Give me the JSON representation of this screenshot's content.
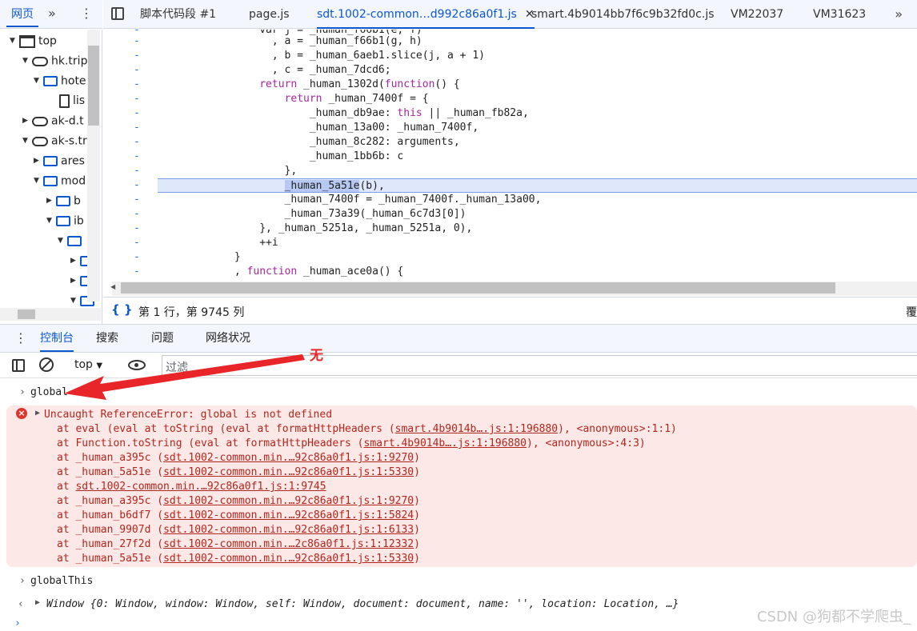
{
  "left_panel": {
    "active_tab": "网页",
    "tree": [
      {
        "label": "top"
      },
      {
        "label": "hk.trip"
      },
      {
        "label": "hote"
      },
      {
        "label": "lis"
      },
      {
        "label": "ak-d.t"
      },
      {
        "label": "ak-s.tr"
      },
      {
        "label": "ares"
      },
      {
        "label": "mod"
      },
      {
        "label": "b"
      },
      {
        "label": "ib"
      },
      {
        "label": ""
      },
      {
        "label": ""
      },
      {
        "label": ""
      },
      {
        "label": ""
      }
    ]
  },
  "file_tabs": [
    {
      "label": "脚本代码段 #1"
    },
    {
      "label": "page.js"
    },
    {
      "label": "sdt.1002-common…d992c86a0f1.js",
      "active": true
    },
    {
      "label": "smart.4b9014bb7f6c9b32fd0c.js"
    },
    {
      "label": "VM22037"
    },
    {
      "label": "VM31623"
    }
  ],
  "code": {
    "gutter_marker": "-",
    "lines": [
      "                var j = _human_f66b1(e, f)",
      "                  , a = _human_f66b1(g, h)",
      "                  , b = _human_6aeb1.slice(j, a + 1)",
      "                  , c = _human_7dcd6;",
      "                return _human_1302d(function() {",
      "                    return _human_7400f = {",
      "                        _human_db9ae: this || _human_fb82a,",
      "                        _human_13a00: _human_7400f,",
      "                        _human_8c282: arguments,",
      "                        _human_1bb6b: c",
      "                    },",
      "                    _human_5a51e(b),",
      "                    _human_7400f = _human_7400f._human_13a00,",
      "                    _human_73a39(_human_6c7d3[0])",
      "                }, _human_5251a, _human_5251a, 0),",
      "                ++i",
      "            }",
      "            , function _human_ace0a() {"
    ],
    "highlighted_line": 11,
    "highlighted_token": "_human_5a51e"
  },
  "status_bar": {
    "position": "第 1 行，第 9745 列",
    "right_text": "覆"
  },
  "drawer_tabs": [
    "控制台",
    "搜索",
    "问题",
    "网络状况"
  ],
  "console_toolbar": {
    "context": "top",
    "filter_placeholder": "过滤"
  },
  "console": {
    "input1": "global",
    "error_title": "Uncaught ReferenceError: global is not defined",
    "stack": [
      {
        "pre": "at eval (eval at toString (eval at formatHttpHeaders (",
        "link": "smart.4b9014b….js:1:196880",
        "post": "), <anonymous>:1:1)"
      },
      {
        "pre": "at Function.toString (eval at formatHttpHeaders (",
        "link": "smart.4b9014b….js:1:196880",
        "post": "), <anonymous>:4:3)"
      },
      {
        "pre": "at _human_a395c (",
        "link": "sdt.1002-common.min.…92c86a0f1.js:1:9270",
        "post": ")"
      },
      {
        "pre": "at _human_5a51e (",
        "link": "sdt.1002-common.min.…92c86a0f1.js:1:5330",
        "post": ")"
      },
      {
        "pre": "at ",
        "link": "sdt.1002-common.min.…92c86a0f1.js:1:9745",
        "post": ""
      },
      {
        "pre": "at _human_a395c (",
        "link": "sdt.1002-common.min.…92c86a0f1.js:1:9270",
        "post": ")"
      },
      {
        "pre": "at _human_b6df7 (",
        "link": "sdt.1002-common.min.…92c86a0f1.js:1:5824",
        "post": ")"
      },
      {
        "pre": "at _human_9907d (",
        "link": "sdt.1002-common.min.…92c86a0f1.js:1:6133",
        "post": ")"
      },
      {
        "pre": "at _human_27f2d (",
        "link": "sdt.1002-common.min.…2c86a0f1.js:1:12332",
        "post": ")"
      },
      {
        "pre": "at _human_5a51e (",
        "link": "sdt.1002-common.min.…92c86a0f1.js:1:5330",
        "post": ")"
      }
    ],
    "input2": "globalThis",
    "result": "Window {0: Window, window: Window, self: Window, document: document, name: '', location: Location, …}"
  },
  "annotation": {
    "text": "无",
    "color": "#e8262a"
  },
  "watermark": "CSDN @狗都不学爬虫_",
  "colors": {
    "accent": "#0b57d0",
    "error_bg": "#fce8e6",
    "error_text": "#b3261e",
    "highlight": "#dfe7fb"
  }
}
